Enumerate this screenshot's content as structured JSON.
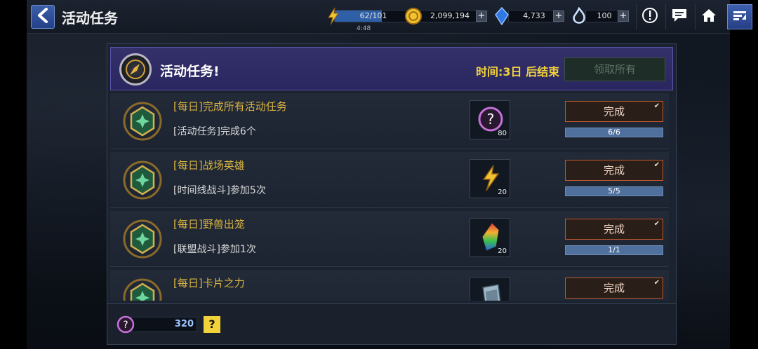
{
  "header": {
    "title": "活动任务",
    "energy": {
      "value": "62/101",
      "timer": "4:48",
      "fill": 0.61
    },
    "gold": {
      "value": "2,099,194"
    },
    "crystal": {
      "value": "4,733"
    },
    "blue_flame": {
      "value": "100"
    },
    "plus": "+"
  },
  "icons": {
    "back": "back-arrow-icon",
    "alert": "exclamation-icon",
    "chat": "chat-icon",
    "home": "home-icon",
    "menu": "menu-icon"
  },
  "panel": {
    "title": "活动任务!",
    "time_left": "时间:3日 后结束",
    "claim_all": "领取所有"
  },
  "missions": [
    {
      "title": "[每日]完成所有活动任务",
      "desc": "[活动任务]完成6个",
      "reward_icon": "mystery-orb-icon",
      "reward_qty": "80",
      "button": "完成",
      "progress": "6/6"
    },
    {
      "title": "[每日]战场英雄",
      "desc": "[时间线战斗]参加5次",
      "reward_icon": "lightning-icon",
      "reward_qty": "20",
      "button": "完成",
      "progress": "5/5"
    },
    {
      "title": "[每日]野兽出笼",
      "desc": "[联盟战斗]参加1次",
      "reward_icon": "rainbow-crystal-icon",
      "reward_qty": "20",
      "button": "完成",
      "progress": "1/1"
    },
    {
      "title": "[每日]卡片之力",
      "desc": "",
      "reward_icon": "card-pack-icon",
      "reward_qty": "",
      "button": "完成",
      "progress": ""
    }
  ],
  "bottom": {
    "currency_value": "320",
    "help_label": "?"
  },
  "colors": {
    "accent_gold": "#d9b440",
    "header_purple": "#34306a",
    "done_border": "#c4582e",
    "progress_blue": "#4f6f9c"
  }
}
